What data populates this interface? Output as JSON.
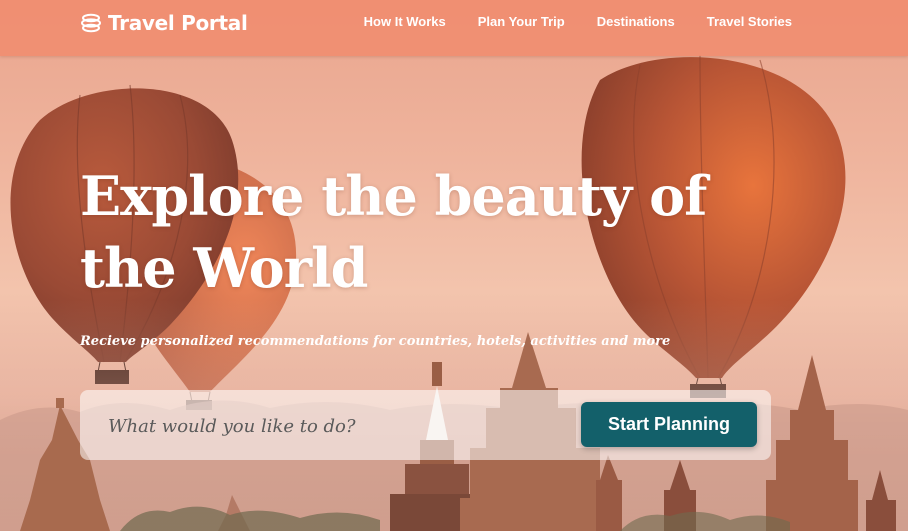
{
  "header": {
    "brand_name": "Travel Portal",
    "brand_icon": "globe-stack-icon",
    "nav": [
      {
        "label": "How It Works"
      },
      {
        "label": "Plan Your Trip"
      },
      {
        "label": "Destinations"
      },
      {
        "label": "Travel Stories"
      }
    ]
  },
  "hero": {
    "title": "Explore the beauty of the World",
    "subtitle": "Recieve personalized recommendations for countries, hotels, activities and more"
  },
  "search": {
    "placeholder": "What would you like to do?",
    "button_label": "Start Planning"
  },
  "colors": {
    "header_bg": "#f08c6e",
    "button_bg": "#13606a",
    "text": "#ffffff"
  }
}
